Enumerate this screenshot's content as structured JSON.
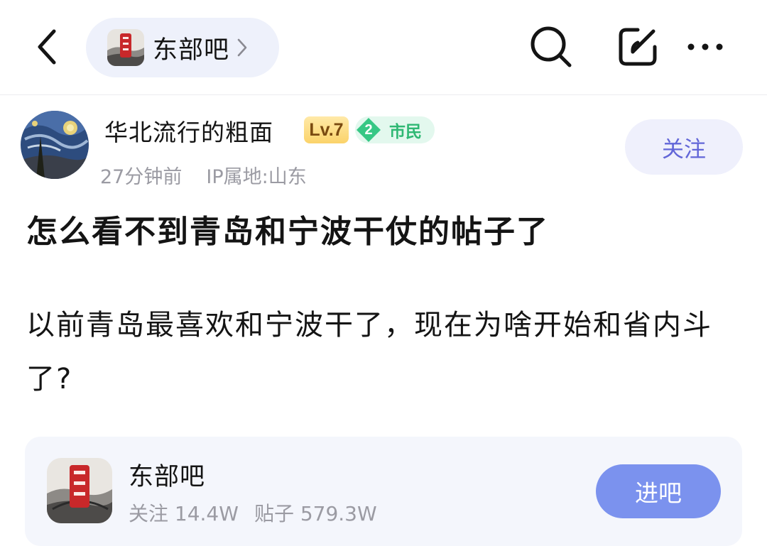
{
  "header": {
    "forum_name": "东部吧"
  },
  "icons": {
    "back": "chevron-left-icon",
    "search": "search-icon",
    "share": "share-icon",
    "more": "more-horizontal-icon"
  },
  "author": {
    "name": "华北流行的粗面",
    "level": "Lv.7",
    "rank_number": "2",
    "rank_title": "市民",
    "time": "27分钟前",
    "ip": "IP属地:山东",
    "follow_label": "关注"
  },
  "post": {
    "title": "怎么看不到青岛和宁波干仗的帖子了",
    "body": "以前青岛最喜欢和宁波干了，现在为啥开始和省内斗了?"
  },
  "forum_card": {
    "name": "东部吧",
    "followers": "关注 14.4W",
    "posts": "贴子 579.3W",
    "enter_label": "进吧"
  },
  "colors": {
    "accent": "#6266d8",
    "enter_button": "#7b92ee",
    "rank_green": "#2fb874",
    "level_gold": "#fbd36a",
    "meta_gray": "#9b9ba3"
  }
}
